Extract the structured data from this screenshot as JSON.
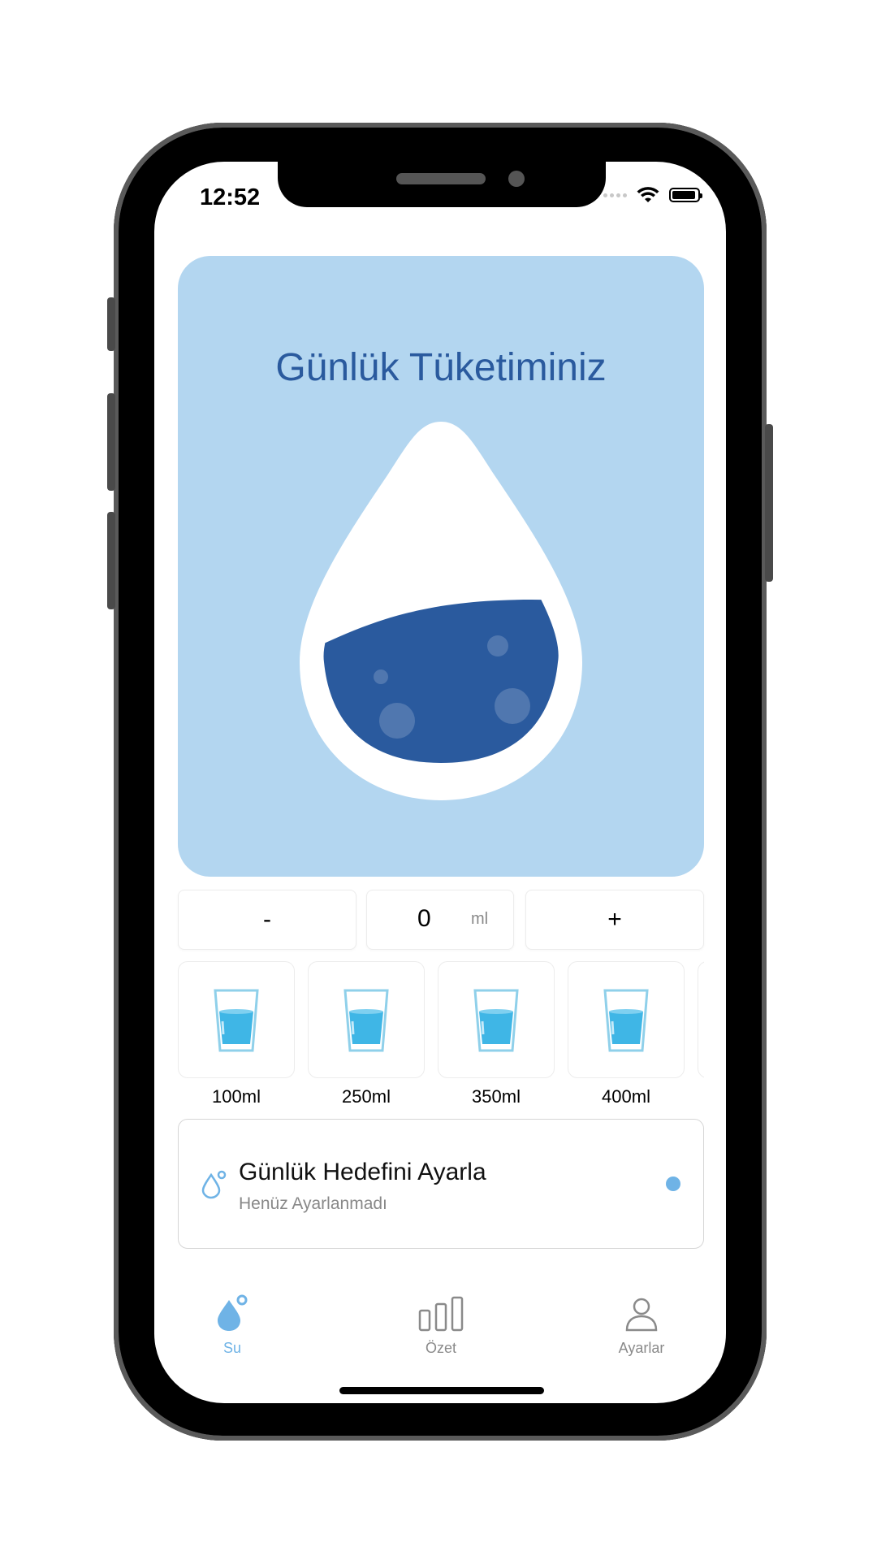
{
  "status_bar": {
    "time": "12:52"
  },
  "hero": {
    "title": "Günlük Tüketiminiz",
    "fill_fraction": 0.45
  },
  "amount": {
    "minus_label": "-",
    "value": "0",
    "unit": "ml",
    "plus_label": "+"
  },
  "glasses": [
    {
      "label": "100ml"
    },
    {
      "label": "250ml"
    },
    {
      "label": "350ml"
    },
    {
      "label": "400ml"
    }
  ],
  "goal": {
    "title": "Günlük Hedefini Ayarla",
    "subtitle": "Henüz Ayarlanmadı"
  },
  "tabs": [
    {
      "label": "Su",
      "icon": "water-drop-icon",
      "active": true
    },
    {
      "label": "Özet",
      "icon": "bar-chart-icon",
      "active": false
    },
    {
      "label": "Ayarlar",
      "icon": "person-icon",
      "active": false
    }
  ],
  "colors": {
    "accent": "#6fb3e6",
    "hero_bg": "#b3d6f0",
    "title": "#2a5a9e",
    "water": "#2a5a9e"
  }
}
